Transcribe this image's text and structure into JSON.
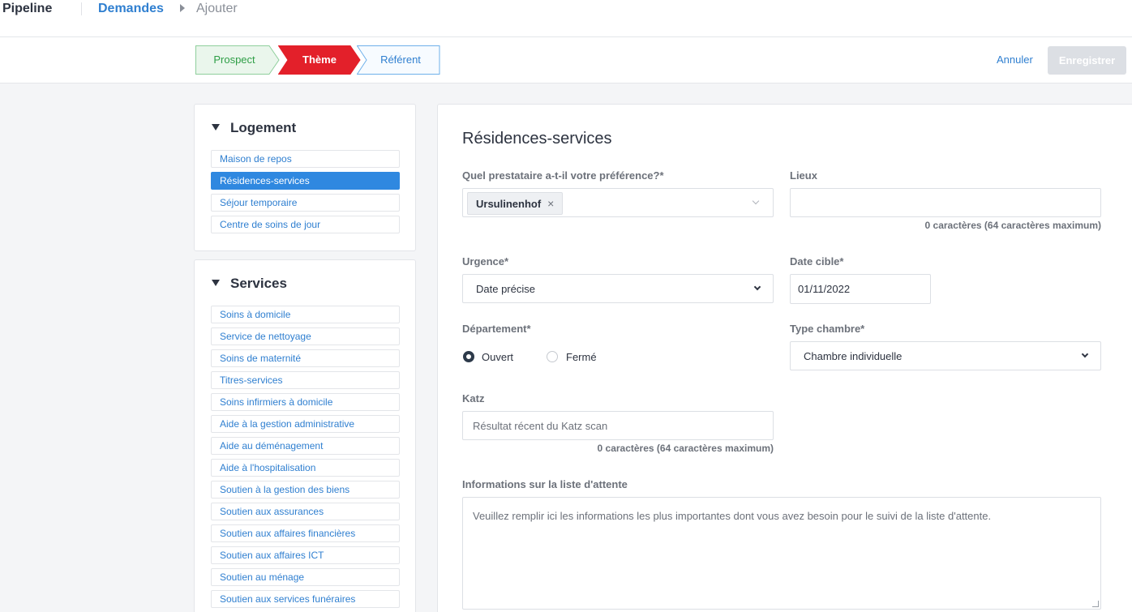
{
  "topbar": {
    "app_title": "Pipeline",
    "breadcrumb_link": "Demandes",
    "breadcrumb_current": "Ajouter"
  },
  "steps": [
    {
      "label": "Prospect",
      "state": "done",
      "color": "#2e9e46",
      "fill": "#eaf6ec",
      "stroke": "#8fcf9c"
    },
    {
      "label": "Thème",
      "state": "current",
      "color": "#ffffff",
      "fill": "#e3202a",
      "stroke": "#e3202a"
    },
    {
      "label": "Référent",
      "state": "todo",
      "color": "#2f7fd0",
      "fill": "#f7fbff",
      "stroke": "#6fb0ea"
    }
  ],
  "actions": {
    "cancel_label": "Annuler",
    "save_label": "Enregistrer"
  },
  "sidebar": {
    "logement": {
      "title": "Logement",
      "items": [
        "Maison de repos",
        "Résidences-services",
        "Séjour temporaire",
        "Centre de soins de jour"
      ],
      "active_index": 1
    },
    "services": {
      "title": "Services",
      "items": [
        "Soins à domicile",
        "Service de nettoyage",
        "Soins de maternité",
        "Titres-services",
        "Soins infirmiers à domicile",
        "Aide à la gestion administrative",
        "Aide au déménagement",
        "Aide à l'hospitalisation",
        "Soutien à la gestion des biens",
        "Soutien aux assurances",
        "Soutien aux affaires financières",
        "Soutien aux affaires ICT",
        "Soutien au ménage",
        "Soutien aux services funéraires"
      ]
    }
  },
  "form": {
    "title": "Résidences-services",
    "prestataire": {
      "label": "Quel prestataire a-t-il votre préférence?*",
      "chip": "Ursulinenhof",
      "remove_icon": "×"
    },
    "lieux": {
      "label": "Lieux",
      "value": "",
      "hint": "0 caractères (64 caractères maximum)"
    },
    "urgence": {
      "label": "Urgence*",
      "value": "Date précise"
    },
    "date_cible": {
      "label": "Date cible*",
      "value": "01/11/2022"
    },
    "departement": {
      "label": "Département*",
      "options": [
        "Ouvert",
        "Fermé"
      ],
      "selected": "Ouvert"
    },
    "type_chambre": {
      "label": "Type chambre*",
      "value": "Chambre individuelle"
    },
    "katz": {
      "label": "Katz",
      "placeholder": "Résultat récent du Katz scan",
      "hint": "0 caractères (64 caractères maximum)"
    },
    "waitlist": {
      "label": "Informations sur la liste d'attente",
      "placeholder": "Veuillez remplir ici les informations les plus importantes dont vous avez besoin pour le suivi de la liste d'attente."
    }
  }
}
